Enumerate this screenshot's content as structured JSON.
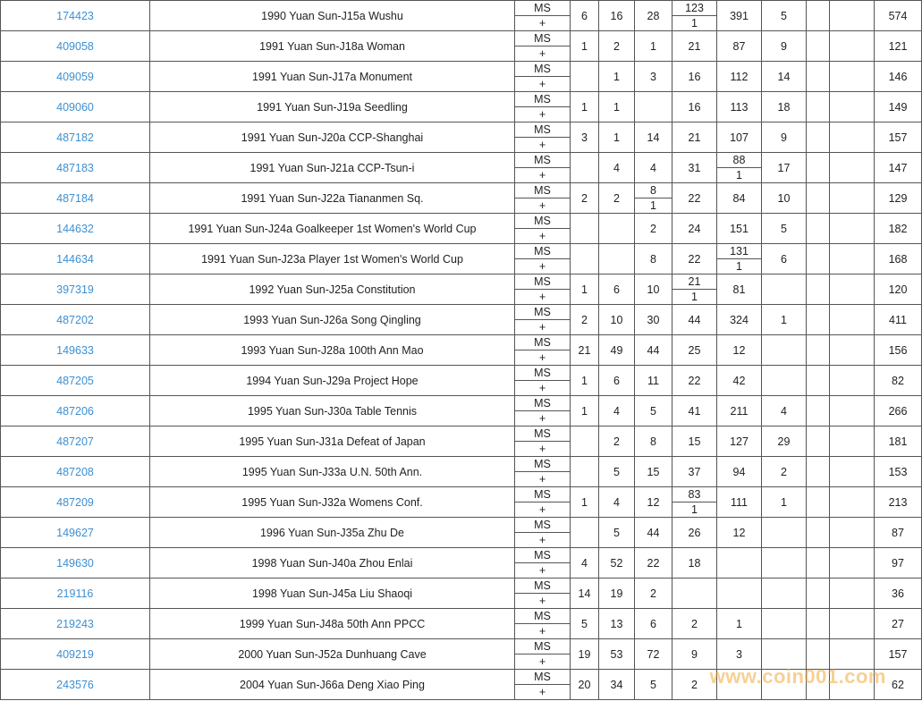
{
  "columns_order": [
    "c1",
    "c2",
    "c3",
    "c4",
    "c5",
    "c6",
    "c7",
    "c8"
  ],
  "grade_top": "MS",
  "grade_bottom": "+",
  "rows": [
    {
      "id": "174423",
      "name": "1990 Yuan Sun-J15a Wushu",
      "cells": {
        "c1": "6",
        "c2": "16",
        "c3": "28",
        "c4": {
          "num": "123",
          "den": "1"
        },
        "c5": "391",
        "c6": "5",
        "c7": "",
        "c8": "574"
      }
    },
    {
      "id": "409058",
      "name": "1991 Yuan Sun-J18a Woman",
      "cells": {
        "c1": "1",
        "c2": "2",
        "c3": "1",
        "c4": "21",
        "c5": "87",
        "c6": "9",
        "c7": "",
        "c8": "121"
      }
    },
    {
      "id": "409059",
      "name": "1991 Yuan Sun-J17a Monument",
      "cells": {
        "c1": "",
        "c2": "1",
        "c3": "3",
        "c4": "16",
        "c5": "112",
        "c6": "14",
        "c7": "",
        "c8": "146"
      }
    },
    {
      "id": "409060",
      "name": "1991 Yuan Sun-J19a Seedling",
      "cells": {
        "c1": "1",
        "c2": "1",
        "c3": "",
        "c4": "16",
        "c5": "113",
        "c6": "18",
        "c7": "",
        "c8": "149"
      }
    },
    {
      "id": "487182",
      "name": "1991 Yuan Sun-J20a CCP-Shanghai",
      "cells": {
        "c1": "3",
        "c2": "1",
        "c3": "14",
        "c4": "21",
        "c5": "107",
        "c6": "9",
        "c7": "",
        "c8": "157"
      }
    },
    {
      "id": "487183",
      "name": "1991 Yuan Sun-J21a CCP-Tsun-i",
      "cells": {
        "c1": "",
        "c2": "4",
        "c3": "4",
        "c4": "31",
        "c5": {
          "num": "88",
          "den": "1"
        },
        "c6": "17",
        "c7": "",
        "c8": "147"
      }
    },
    {
      "id": "487184",
      "name": "1991 Yuan Sun-J22a Tiananmen Sq.",
      "cells": {
        "c1": "2",
        "c2": "2",
        "c3": {
          "num": "8",
          "den": "1"
        },
        "c4": "22",
        "c5": "84",
        "c6": "10",
        "c7": "",
        "c8": "129"
      }
    },
    {
      "id": "144632",
      "name": "1991 Yuan Sun-J24a Goalkeeper 1st Women's World Cup",
      "cells": {
        "c1": "",
        "c2": "",
        "c3": "2",
        "c4": "24",
        "c5": "151",
        "c6": "5",
        "c7": "",
        "c8": "182"
      }
    },
    {
      "id": "144634",
      "name": "1991 Yuan Sun-J23a Player 1st Women's World Cup",
      "cells": {
        "c1": "",
        "c2": "",
        "c3": "8",
        "c4": "22",
        "c5": {
          "num": "131",
          "den": "1"
        },
        "c6": "6",
        "c7": "",
        "c8": "168"
      }
    },
    {
      "id": "397319",
      "name": "1992 Yuan Sun-J25a Constitution",
      "cells": {
        "c1": "1",
        "c2": "6",
        "c3": "10",
        "c4": {
          "num": "21",
          "den": "1"
        },
        "c5": "81",
        "c6": "",
        "c7": "",
        "c8": "120"
      }
    },
    {
      "id": "487202",
      "name": "1993 Yuan Sun-J26a Song Qingling",
      "cells": {
        "c1": "2",
        "c2": "10",
        "c3": "30",
        "c4": "44",
        "c5": "324",
        "c6": "1",
        "c7": "",
        "c8": "411"
      }
    },
    {
      "id": "149633",
      "name": "1993 Yuan Sun-J28a 100th Ann Mao",
      "cells": {
        "c1": "21",
        "c2": "49",
        "c3": "44",
        "c4": "25",
        "c5": "12",
        "c6": "",
        "c7": "",
        "c8": "156"
      }
    },
    {
      "id": "487205",
      "name": "1994 Yuan Sun-J29a Project Hope",
      "cells": {
        "c1": "1",
        "c2": "6",
        "c3": "11",
        "c4": "22",
        "c5": "42",
        "c6": "",
        "c7": "",
        "c8": "82"
      }
    },
    {
      "id": "487206",
      "name": "1995 Yuan Sun-J30a Table Tennis",
      "cells": {
        "c1": "1",
        "c2": "4",
        "c3": "5",
        "c4": "41",
        "c5": "211",
        "c6": "4",
        "c7": "",
        "c8": "266"
      }
    },
    {
      "id": "487207",
      "name": "1995 Yuan Sun-J31a Defeat of Japan",
      "cells": {
        "c1": "",
        "c2": "2",
        "c3": "8",
        "c4": "15",
        "c5": "127",
        "c6": "29",
        "c7": "",
        "c8": "181"
      }
    },
    {
      "id": "487208",
      "name": "1995 Yuan Sun-J33a U.N. 50th Ann.",
      "cells": {
        "c1": "",
        "c2": "5",
        "c3": "15",
        "c4": "37",
        "c5": "94",
        "c6": "2",
        "c7": "",
        "c8": "153"
      }
    },
    {
      "id": "487209",
      "name": "1995 Yuan Sun-J32a Womens Conf.",
      "cells": {
        "c1": "1",
        "c2": "4",
        "c3": "12",
        "c4": {
          "num": "83",
          "den": "1"
        },
        "c5": "111",
        "c6": "1",
        "c7": "",
        "c8": "213"
      }
    },
    {
      "id": "149627",
      "name": "1996 Yuan Sun-J35a Zhu De",
      "cells": {
        "c1": "",
        "c2": "5",
        "c3": "44",
        "c4": "26",
        "c5": "12",
        "c6": "",
        "c7": "",
        "c8": "87"
      }
    },
    {
      "id": "149630",
      "name": "1998 Yuan Sun-J40a Zhou Enlai",
      "cells": {
        "c1": "4",
        "c2": "52",
        "c3": "22",
        "c4": "18",
        "c5": "",
        "c6": "",
        "c7": "",
        "c8": "97"
      }
    },
    {
      "id": "219116",
      "name": "1998 Yuan Sun-J45a Liu Shaoqi",
      "cells": {
        "c1": "14",
        "c2": "19",
        "c3": "2",
        "c4": "",
        "c5": "",
        "c6": "",
        "c7": "",
        "c8": "36"
      }
    },
    {
      "id": "219243",
      "name": "1999 Yuan Sun-J48a 50th Ann PPCC",
      "cells": {
        "c1": "5",
        "c2": "13",
        "c3": "6",
        "c4": "2",
        "c5": "1",
        "c6": "",
        "c7": "",
        "c8": "27"
      }
    },
    {
      "id": "409219",
      "name": "2000 Yuan Sun-J52a Dunhuang Cave",
      "cells": {
        "c1": "19",
        "c2": "53",
        "c3": "72",
        "c4": "9",
        "c5": "3",
        "c6": "",
        "c7": "",
        "c8": "157"
      }
    },
    {
      "id": "243576",
      "name": "2004 Yuan Sun-J66a Deng Xiao Ping",
      "cells": {
        "c1": "20",
        "c2": "34",
        "c3": "5",
        "c4": "2",
        "c5": "",
        "c6": "",
        "c7": "",
        "c8": "62"
      }
    }
  ],
  "watermark": "www.coin001.com"
}
